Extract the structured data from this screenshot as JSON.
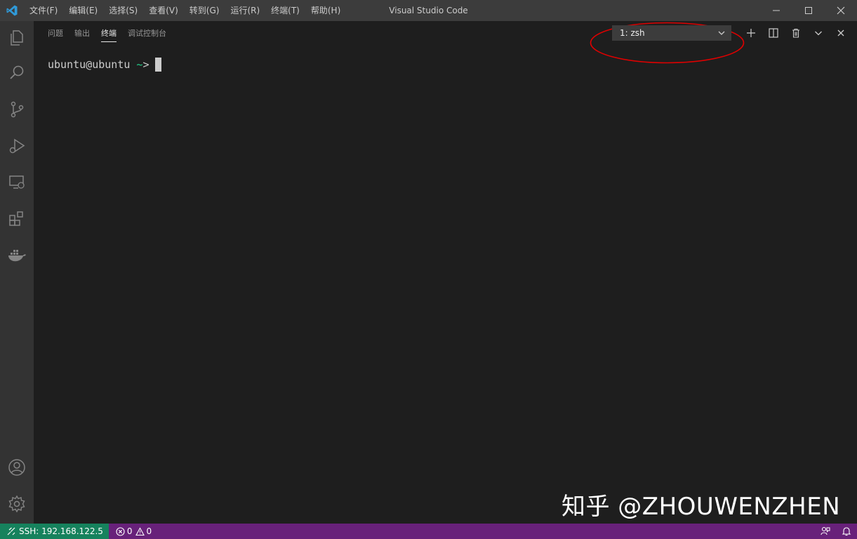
{
  "window": {
    "title": "Visual Studio Code",
    "menu": [
      "文件(F)",
      "编辑(E)",
      "选择(S)",
      "查看(V)",
      "转到(G)",
      "运行(R)",
      "终端(T)",
      "帮助(H)"
    ]
  },
  "activity_bar": {
    "top_icons": [
      "files-icon",
      "search-icon",
      "source-control-icon",
      "run-debug-icon",
      "remote-explorer-icon",
      "extensions-icon",
      "docker-icon"
    ],
    "bottom_icons": [
      "account-icon",
      "settings-gear-icon"
    ]
  },
  "panel": {
    "tabs": [
      {
        "label": "问题",
        "active": false
      },
      {
        "label": "输出",
        "active": false
      },
      {
        "label": "终端",
        "active": true
      },
      {
        "label": "调试控制台",
        "active": false
      }
    ],
    "terminal_select": "1: zsh",
    "actions": [
      "new-terminal-icon",
      "split-terminal-icon",
      "kill-terminal-icon",
      "maximize-panel-icon",
      "close-panel-icon"
    ]
  },
  "terminal": {
    "prompt_user": "ubuntu@ubuntu",
    "prompt_dir": "~",
    "prompt_symbol": ">"
  },
  "watermark": "知乎 @ZHOUWENZHEN",
  "statusbar": {
    "remote": "SSH: 192.168.122.5",
    "errors": "0",
    "warnings": "0"
  },
  "colors": {
    "titlebar": "#3c3c3c",
    "activitybar": "#333333",
    "editor_bg": "#1e1e1e",
    "statusbar": "#68217a",
    "remote_indicator": "#16825d",
    "annotation": "#e00000"
  }
}
